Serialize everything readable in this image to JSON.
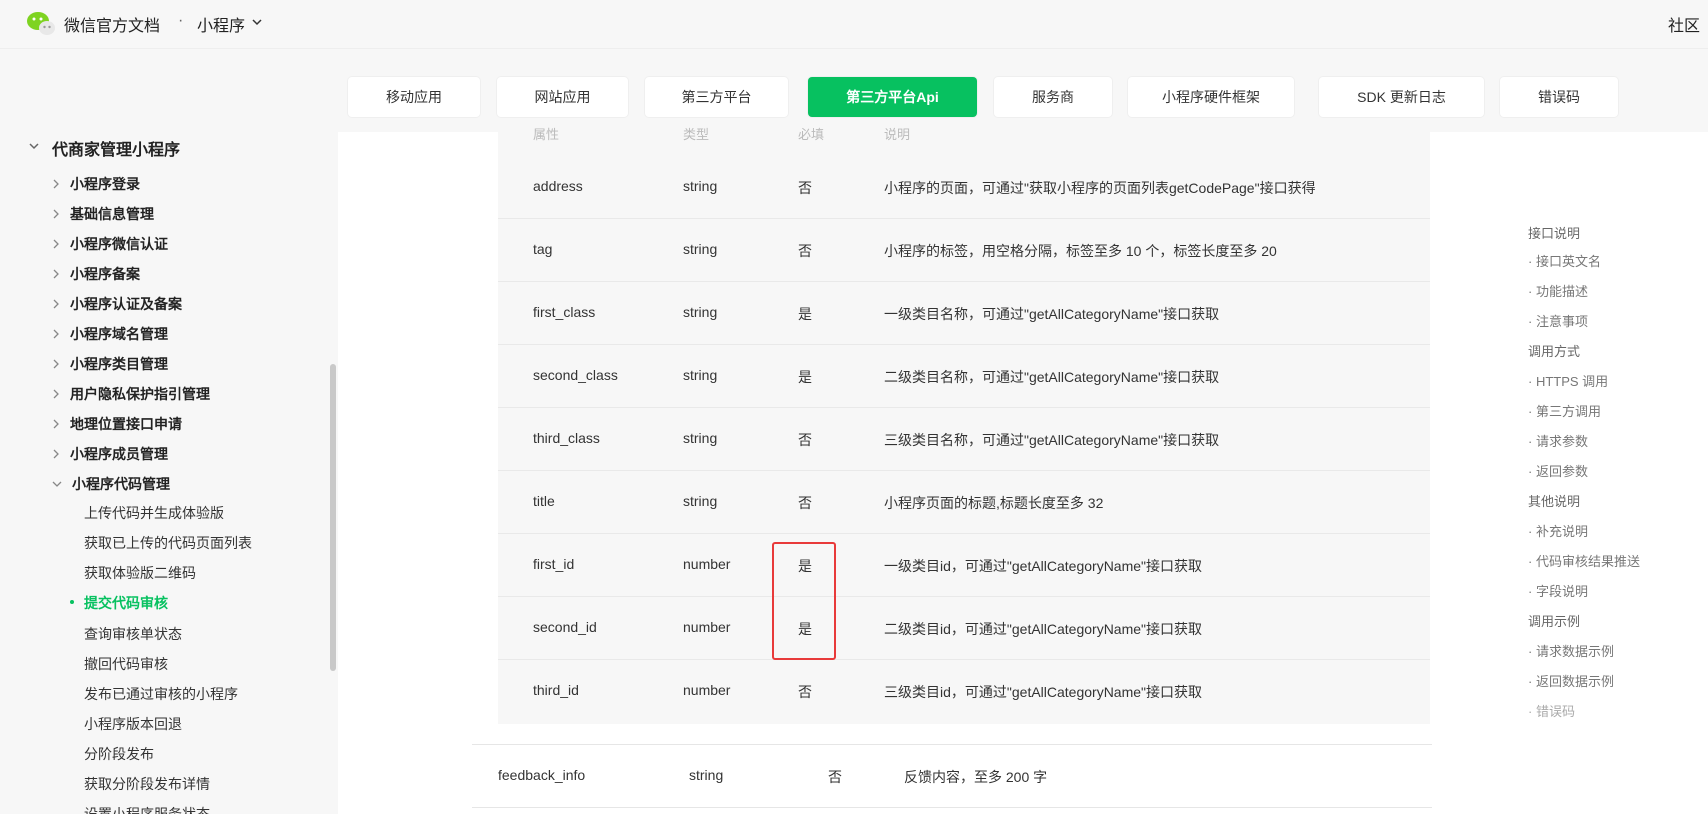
{
  "header": {
    "brand": "微信官方文档",
    "separator": "·",
    "product": "小程序",
    "community": "社区"
  },
  "nav": {
    "items": [
      {
        "label": "移动应用"
      },
      {
        "label": "网站应用"
      },
      {
        "label": "第三方平台"
      },
      {
        "label": "第三方平台Api",
        "active": true
      },
      {
        "label": "服务商"
      },
      {
        "label": "小程序硬件框架"
      },
      {
        "label": "SDK 更新日志"
      },
      {
        "label": "错误码"
      }
    ]
  },
  "sidebar": {
    "title": "代商家管理小程序",
    "items": [
      {
        "label": "小程序登录"
      },
      {
        "label": "基础信息管理"
      },
      {
        "label": "小程序微信认证"
      },
      {
        "label": "小程序备案"
      },
      {
        "label": "小程序认证及备案"
      },
      {
        "label": "小程序域名管理"
      },
      {
        "label": "小程序类目管理"
      },
      {
        "label": "用户隐私保护指引管理"
      },
      {
        "label": "地理位置接口申请"
      },
      {
        "label": "小程序成员管理"
      },
      {
        "label": "小程序代码管理",
        "expanded": true
      }
    ],
    "subitems": [
      {
        "label": "上传代码并生成体验版"
      },
      {
        "label": "获取已上传的代码页面列表"
      },
      {
        "label": "获取体验版二维码"
      },
      {
        "label": "提交代码审核",
        "active": true
      },
      {
        "label": "查询审核单状态"
      },
      {
        "label": "撤回代码审核"
      },
      {
        "label": "发布已通过审核的小程序"
      },
      {
        "label": "小程序版本回退"
      },
      {
        "label": "分阶段发布"
      },
      {
        "label": "获取分阶段发布详情"
      },
      {
        "label": "设置小程序服务状态"
      }
    ]
  },
  "table": {
    "ghost_headers": [
      "属性",
      "类型",
      "必填",
      "说明"
    ],
    "rows": [
      {
        "name": "address",
        "type": "string",
        "required": "否",
        "desc": "小程序的页面，可通过\"获取小程序的页面列表getCodePage\"接口获得"
      },
      {
        "name": "tag",
        "type": "string",
        "required": "否",
        "desc": "小程序的标签，用空格分隔，标签至多 10 个，标签长度至多 20"
      },
      {
        "name": "first_class",
        "type": "string",
        "required": "是",
        "desc": "一级类目名称，可通过\"getAllCategoryName\"接口获取"
      },
      {
        "name": "second_class",
        "type": "string",
        "required": "是",
        "desc": "二级类目名称，可通过\"getAllCategoryName\"接口获取"
      },
      {
        "name": "third_class",
        "type": "string",
        "required": "否",
        "desc": "三级类目名称，可通过\"getAllCategoryName\"接口获取"
      },
      {
        "name": "title",
        "type": "string",
        "required": "否",
        "desc": "小程序页面的标题,标题长度至多 32"
      },
      {
        "name": "first_id",
        "type": "number",
        "required": "是",
        "desc": "一级类目id，可通过\"getAllCategoryName\"接口获取"
      },
      {
        "name": "second_id",
        "type": "number",
        "required": "是",
        "desc": "二级类目id，可通过\"getAllCategoryName\"接口获取"
      },
      {
        "name": "third_id",
        "type": "number",
        "required": "否",
        "desc": "三级类目id，可通过\"getAllCategoryName\"接口获取"
      }
    ],
    "outer_row": {
      "name": "feedback_info",
      "type": "string",
      "required": "否",
      "desc": "反馈内容，至多 200 字"
    }
  },
  "toc": {
    "items": [
      {
        "label": "接口说明",
        "level": 1
      },
      {
        "label": "· 接口英文名",
        "level": 2
      },
      {
        "label": "· 功能描述",
        "level": 2
      },
      {
        "label": "· 注意事项",
        "level": 2
      },
      {
        "label": "调用方式",
        "level": 1
      },
      {
        "label": "· HTTPS 调用",
        "level": 2
      },
      {
        "label": "· 第三方调用",
        "level": 2
      },
      {
        "label": "· 请求参数",
        "level": 2
      },
      {
        "label": "· 返回参数",
        "level": 2
      },
      {
        "label": "其他说明",
        "level": 1
      },
      {
        "label": "· 补充说明",
        "level": 2
      },
      {
        "label": "· 代码审核结果推送",
        "level": 2
      },
      {
        "label": "· 字段说明",
        "level": 2
      },
      {
        "label": "调用示例",
        "level": 1
      },
      {
        "label": "· 请求数据示例",
        "level": 2
      },
      {
        "label": "· 返回数据示例",
        "level": 2
      },
      {
        "label": "· 错误码",
        "level": 2,
        "dim": true
      }
    ]
  },
  "colors": {
    "accent": "#07c160",
    "highlight": "#e83a3a"
  }
}
